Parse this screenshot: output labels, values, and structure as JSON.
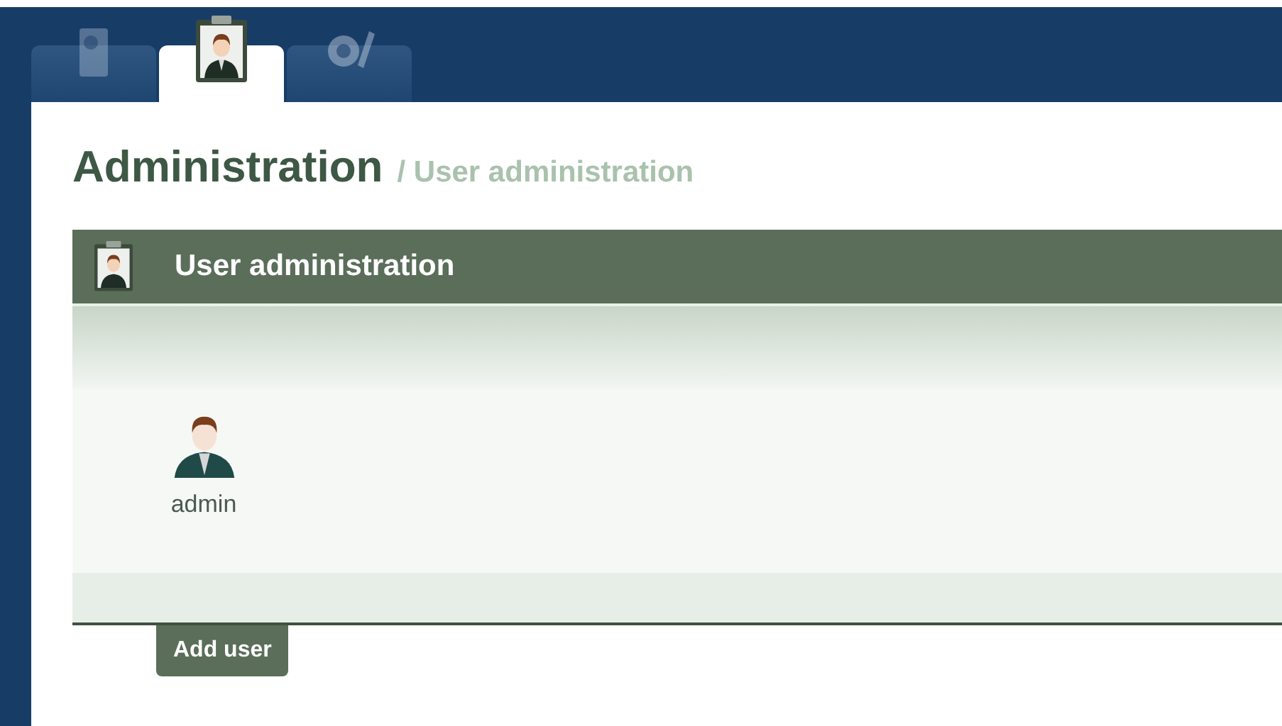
{
  "tabs": [
    {
      "kind": "settings-doc",
      "selected": false
    },
    {
      "kind": "users",
      "selected": true
    },
    {
      "kind": "tools",
      "selected": false
    }
  ],
  "heading": {
    "title": "Administration",
    "breadcrumb": "/ User administration"
  },
  "panel": {
    "title": "User administration",
    "users": [
      {
        "name": "admin"
      }
    ]
  },
  "buttons": [
    "Add user"
  ]
}
